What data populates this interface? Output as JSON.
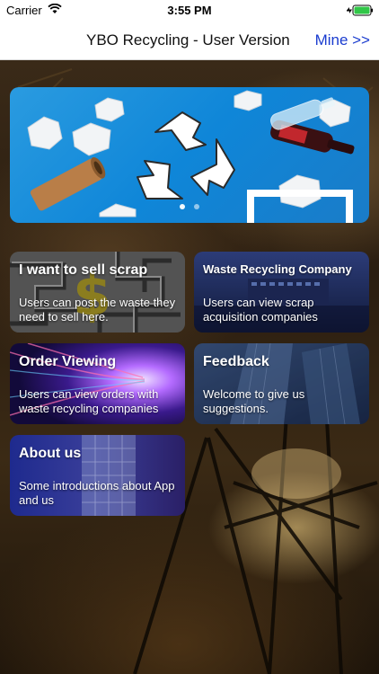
{
  "status_bar": {
    "carrier": "Carrier",
    "time": "3:55 PM"
  },
  "nav": {
    "title": "YBO Recycling - User Version",
    "mine_label": "Mine >>"
  },
  "banner": {
    "page_count": 2,
    "active_page": 1
  },
  "cards": [
    {
      "title": "I want to sell scrap",
      "description": "Users can post the waste they need to sell here."
    },
    {
      "title": "Waste Recycling Company",
      "description": "Users can view scrap acquisition companies"
    },
    {
      "title": "Order Viewing",
      "description": "Users can view orders with waste recycling companies"
    },
    {
      "title": "Feedback",
      "description": "Welcome to give us suggestions."
    },
    {
      "title": "About us",
      "description": "Some introductions about App and us"
    }
  ],
  "colors": {
    "link": "#1a3ccf",
    "banner_blue": "#0f86d8"
  }
}
